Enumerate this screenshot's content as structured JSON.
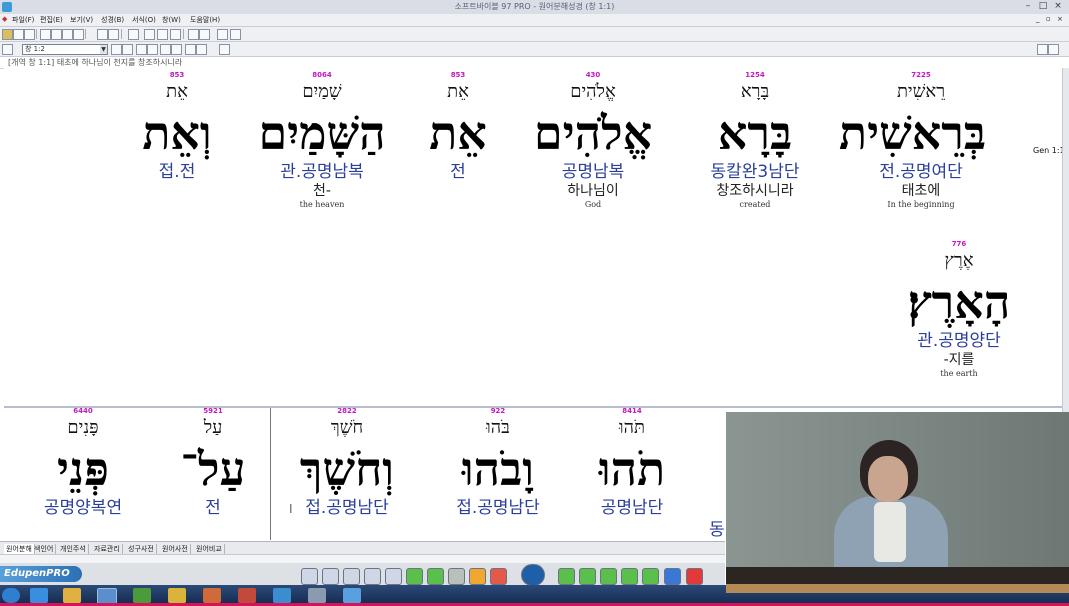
{
  "window": {
    "title": "소프트바이블 97 PRO - 원어분해성경 (창 1:1)",
    "controls": [
      "–",
      "□",
      "×"
    ]
  },
  "menu": [
    "파일(F)",
    "편집(E)",
    "보기(V)",
    "성경(B)",
    "서식(O)",
    "창(W)",
    "도움말(H)"
  ],
  "toolbar": {
    "chapter_select": "창 1:2"
  },
  "verse_header": "[개역 창 1:1] 태초에 하나님이 천지를 창조하시니라",
  "reference_label": "Gen 1:1",
  "top_words": [
    {
      "num": "7225",
      "lemma": "רֵאשִׁית",
      "heb": "בְּרֵאשִׁית",
      "parse": "전.공명여단",
      "kor": "태초에",
      "eng": "In the beginning"
    },
    {
      "num": "1254",
      "lemma": "בָּרָא",
      "heb": "בָּרָא",
      "parse": "동칼완3남단",
      "kor": "창조하시니라",
      "eng": "created"
    },
    {
      "num": "430",
      "lemma": "אֱלֹהִים",
      "heb": "אֱלֹהִים",
      "parse": "공명남복",
      "kor": "하나님이",
      "eng": "God"
    },
    {
      "num": "853",
      "lemma": "אֵת",
      "heb": "אֵת",
      "parse": "전",
      "kor": "",
      "eng": ""
    },
    {
      "num": "8064",
      "lemma": "שָׁמַיִם",
      "heb": "הַשָּׁמַיִם",
      "parse": "관.공명남복",
      "kor": "천-",
      "eng": "the heaven"
    },
    {
      "num": "853",
      "lemma": "אֵת",
      "heb": "וְאֵת",
      "parse": "접.전",
      "kor": "",
      "eng": ""
    }
  ],
  "second_row_word": {
    "num": "776",
    "lemma": "אֶרֶץ",
    "heb": "הָאָרֶץ׃",
    "parse": "관.공명양단",
    "kor": "-지를",
    "eng": "the earth"
  },
  "bottom_words": [
    {
      "num": "8414",
      "lemma": "תֹּהוּ",
      "heb": "תֹהוּ",
      "parse": "공명남단"
    },
    {
      "num": "922",
      "lemma": "בֹּהוּ",
      "heb": "וָבֹהוּ",
      "parse": "접.공명남단"
    },
    {
      "num": "2822",
      "lemma": "חֹשֶׁךְ",
      "heb": "וְחֹשֶׁךְ",
      "parse": "접.공명남단"
    },
    {
      "num": "5921",
      "lemma": "עַל",
      "heb": "עַל־",
      "parse": "전"
    },
    {
      "num": "6440",
      "lemma": "פָּנִים",
      "heb": "פְּנֵי",
      "parse": "공명양복연"
    }
  ],
  "bottom_partial_parse": "동",
  "tabs": [
    "원어분해",
    "색인어",
    "개인주석",
    "자료관리",
    "성구사전",
    "원어사전",
    "원어비교"
  ],
  "edupen_logo": "EdupenPRO",
  "colors": {
    "strongs_number": "#c218c2",
    "parse": "#2a3f9a",
    "taskbar": "#13284c",
    "taskbar_accent": "#d4145a"
  }
}
